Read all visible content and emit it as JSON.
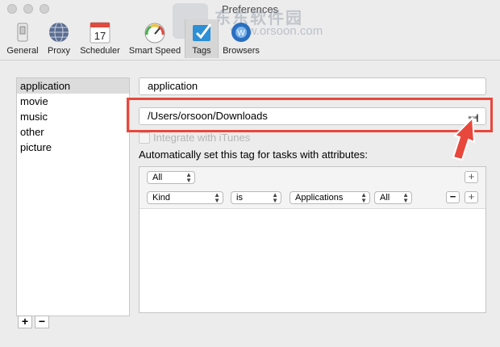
{
  "window": {
    "title": "Preferences"
  },
  "watermark": {
    "text": "东东软件园",
    "url": "www.orsoon.com"
  },
  "toolbar": {
    "items": [
      {
        "label": "General",
        "icon": "general-switch-icon"
      },
      {
        "label": "Proxy",
        "icon": "globe-icon"
      },
      {
        "label": "Scheduler",
        "icon": "calendar-icon",
        "badge": "17"
      },
      {
        "label": "Smart Speed",
        "icon": "speedometer-icon"
      },
      {
        "label": "Tags",
        "icon": "tag-check-icon",
        "active": true
      },
      {
        "label": "Browsers",
        "icon": "browser-icon"
      }
    ]
  },
  "tags": {
    "list": [
      "application",
      "movie",
      "music",
      "other",
      "picture"
    ],
    "selected": "application",
    "add_label": "+",
    "remove_label": "−"
  },
  "detail": {
    "tag_name": "application",
    "folder_path": "/Users/orsoon/Downloads",
    "browse_label": "•••",
    "itunes_label": "Integrate with iTunes",
    "auto_label": "Automatically set this tag for tasks with attributes:"
  },
  "rules": {
    "match": "All",
    "condition": {
      "attribute": "Kind",
      "operator": "is",
      "value": "Applications",
      "scope": "All"
    },
    "add_label": "+",
    "remove_label": "−"
  },
  "colors": {
    "highlight": "#e8473c",
    "background": "#ececec"
  }
}
